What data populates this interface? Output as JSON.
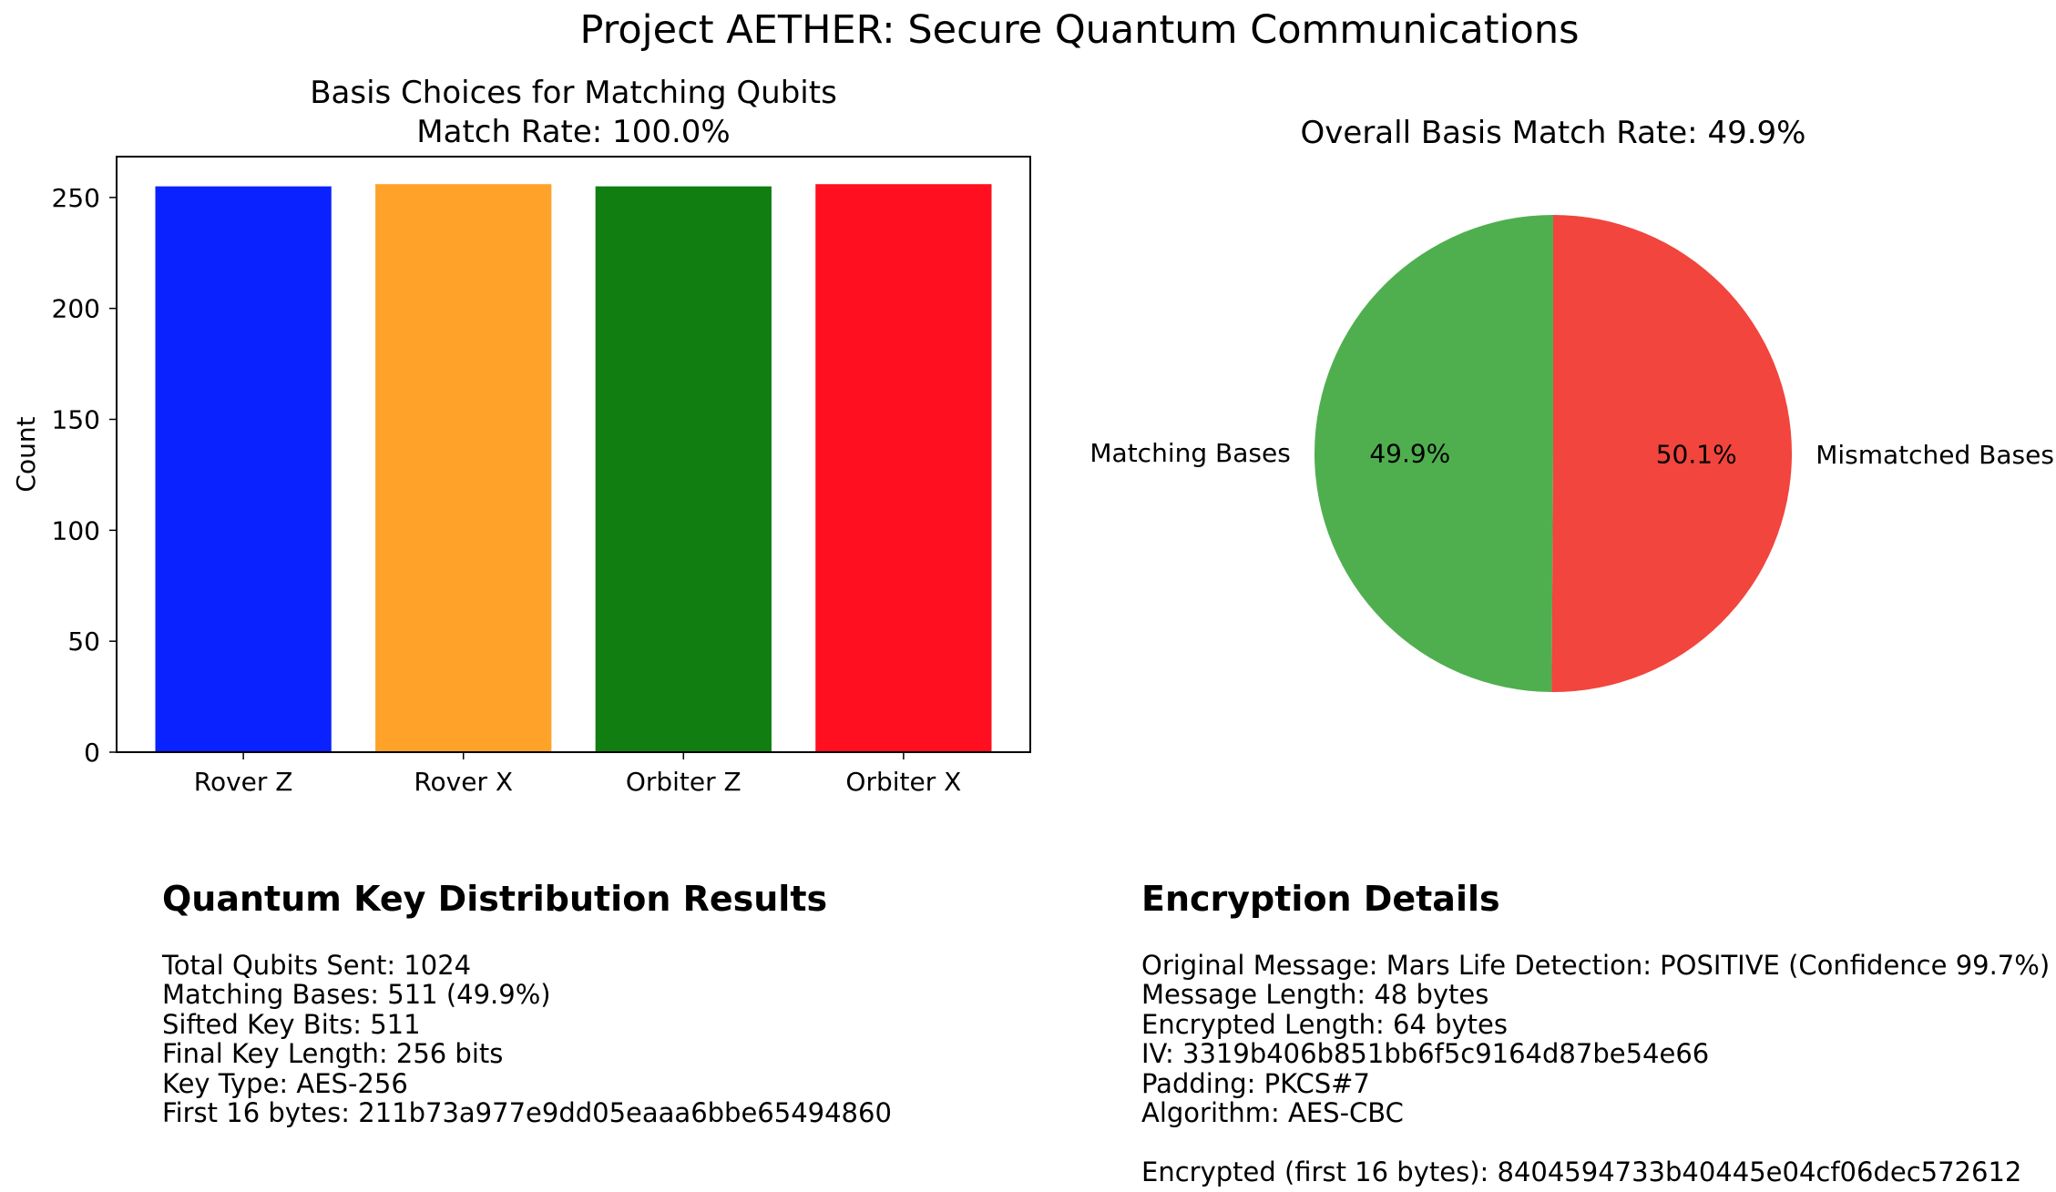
{
  "figure_title": "Project AETHER: Secure Quantum Communications",
  "chart_data": [
    {
      "type": "bar",
      "title": "Basis Choices for Matching Qubits\nMatch Rate: 100.0%",
      "xlabel": "",
      "ylabel": "Count",
      "categories": [
        "Rover Z",
        "Rover X",
        "Orbiter Z",
        "Orbiter X"
      ],
      "values": [
        255,
        256,
        255,
        256
      ],
      "colors": [
        "#0a22ff",
        "#ffa22a",
        "#107e10",
        "#ff0f1f"
      ],
      "yticks": [
        0,
        50,
        100,
        150,
        200,
        250
      ],
      "ylim": [
        0,
        268.4
      ],
      "grid": false
    },
    {
      "type": "pie",
      "title": "Overall Basis Match Rate: 49.9%",
      "labels": [
        "Matching Bases",
        "Mismatched Bases"
      ],
      "values": [
        49.9,
        50.1
      ],
      "pct_labels": [
        "49.9%",
        "50.1%"
      ],
      "colors": [
        "#4faf4f",
        "#f1453d"
      ]
    }
  ],
  "qkd_panel": {
    "heading": "Quantum Key Distribution Results",
    "lines": [
      "Total Qubits Sent: 1024",
      "Matching Bases: 511 (49.9%)",
      "Sifted Key Bits: 511",
      "Final Key Length: 256 bits",
      "Key Type: AES-256",
      "First 16 bytes: 211b73a977e9dd05eaaa6bbe65494860"
    ]
  },
  "encryption_panel": {
    "heading": "Encryption Details",
    "lines": [
      "Original Message: Mars Life Detection: POSITIVE (Confidence 99.7%)",
      "Message Length: 48 bytes",
      "Encrypted Length: 64 bytes",
      "IV: 3319b406b851bb6f5c9164d87be54e66",
      "Padding: PKCS#7",
      "Algorithm: AES-CBC"
    ],
    "encrypted_line": "Encrypted (first 16 bytes): 8404594733b40445e04cf06dec572612"
  }
}
